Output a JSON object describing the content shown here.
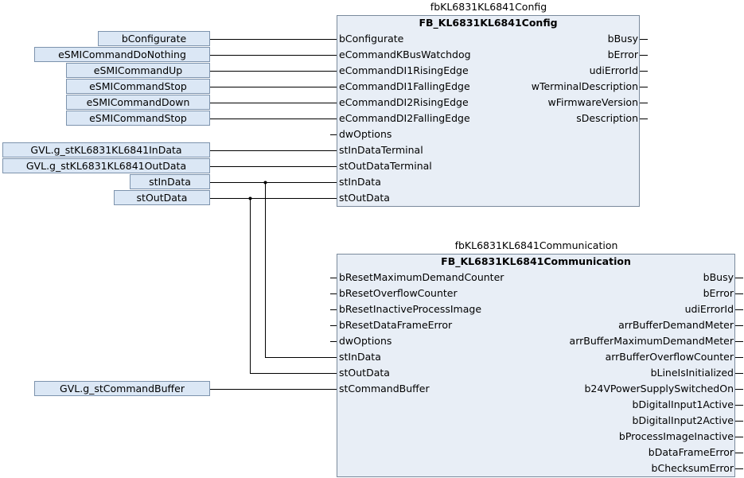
{
  "fb1": {
    "instance": "fbKL6831KL6841Config",
    "type": "FB_KL6831KL6841Config",
    "inputs": [
      "bConfigurate",
      "eCommandKBusWatchdog",
      "eCommandDI1RisingEdge",
      "eCommandDI1FallingEdge",
      "eCommandDI2RisingEdge",
      "eCommandDI2FallingEdge",
      "dwOptions",
      "stInDataTerminal",
      "stOutDataTerminal",
      "stInData",
      "stOutData"
    ],
    "outputs": [
      "bBusy",
      "bError",
      "udiErrorId",
      "wTerminalDescription",
      "wFirmwareVersion",
      "sDescription"
    ]
  },
  "fb1_vars": [
    "bConfigurate",
    "eSMICommandDoNothing",
    "eSMICommandUp",
    "eSMICommandStop",
    "eSMICommandDown",
    "eSMICommandStop",
    "",
    "GVL.g_stKL6831KL6841InData",
    "GVL.g_stKL6831KL6841OutData",
    "stInData",
    "stOutData"
  ],
  "fb2": {
    "instance": "fbKL6831KL6841Communication",
    "type": "FB_KL6831KL6841Communication",
    "inputs": [
      "bResetMaximumDemandCounter",
      "bResetOverflowCounter",
      "bResetInactiveProcessImage",
      "bResetDataFrameError",
      "dwOptions",
      "stInData",
      "stOutData",
      "stCommandBuffer"
    ],
    "outputs": [
      "bBusy",
      "bError",
      "udiErrorId",
      "arrBufferDemandMeter",
      "arrBufferMaximumDemandMeter",
      "arrBufferOverflowCounter",
      "bLineIsInitialized",
      "b24VPowerSupplySwitchedOn",
      "bDigitalInput1Active",
      "bDigitalInput2Active",
      "bProcessImageInactive",
      "bDataFrameError",
      "bChecksumError"
    ]
  },
  "fb2_vars": [
    "",
    "",
    "",
    "",
    "",
    "",
    "",
    "GVL.g_stCommandBuffer"
  ]
}
